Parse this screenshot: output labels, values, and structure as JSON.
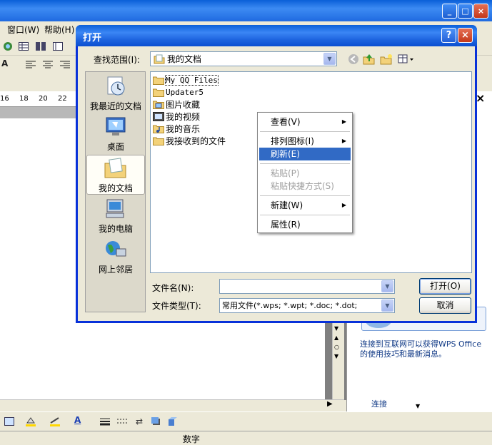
{
  "background_app": {
    "menus": [
      "窗口(W)",
      "帮助(H)"
    ],
    "ruler_ticks": [
      "16",
      "18",
      "20",
      "22"
    ],
    "taskpane_text": "连接到互联网可以获得WPS Office 的使用技巧和最新消息。",
    "taskpane_partial": "连接",
    "status_text": "数字",
    "window_buttons": [
      "_",
      "□",
      "×"
    ]
  },
  "dialog": {
    "title": "打开",
    "help_label": "?",
    "close_label": "×",
    "lookin_label": "查找范围(I):",
    "lookin_value": "我的文档",
    "places": [
      {
        "label": "我最近的文档",
        "icon": "recent-documents-icon"
      },
      {
        "label": "桌面",
        "icon": "desktop-icon"
      },
      {
        "label": "我的文档",
        "icon": "my-documents-icon",
        "active": true
      },
      {
        "label": "我的电脑",
        "icon": "my-computer-icon"
      },
      {
        "label": "网上邻居",
        "icon": "network-places-icon"
      }
    ],
    "files": [
      {
        "name": "My QQ Files",
        "icon": "folder-icon"
      },
      {
        "name": "Updater5",
        "icon": "folder-icon"
      },
      {
        "name": "图片收藏",
        "icon": "pictures-folder-icon"
      },
      {
        "name": "我的视频",
        "icon": "video-folder-icon"
      },
      {
        "name": "我的音乐",
        "icon": "music-folder-icon"
      },
      {
        "name": "我接收到的文件",
        "icon": "folder-icon"
      }
    ],
    "context_menu": [
      {
        "label": "查看(V)",
        "submenu": true
      },
      {
        "label": "排列图标(I)",
        "submenu": true
      },
      {
        "label": "刷新(E)",
        "highlighted": true
      },
      {
        "label": "粘贴(P)",
        "disabled": true
      },
      {
        "label": "粘贴快捷方式(S)",
        "disabled": true
      },
      {
        "label": "新建(W)",
        "submenu": true
      },
      {
        "label": "属性(R)"
      }
    ],
    "filename_label": "文件名(N):",
    "filename_value": "",
    "filetype_label": "文件类型(T):",
    "filetype_value": "常用文件(*.wps; *.wpt; *.doc; *.dot;",
    "open_button": "打开(O)",
    "cancel_button": "取消"
  },
  "colors": {
    "title_blue": "#0a5fd8",
    "highlight": "#316ac5",
    "close_red": "#c4381a"
  }
}
